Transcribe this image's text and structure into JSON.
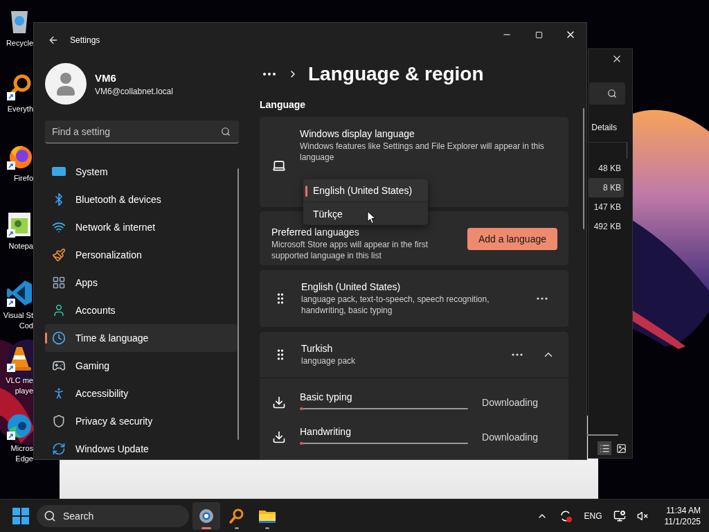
{
  "desktop": {
    "icons": [
      {
        "label": "Recycle",
        "kind": "recycle"
      },
      {
        "label": "Everyth",
        "kind": "everything"
      },
      {
        "label": "Firefo",
        "kind": "firefox"
      },
      {
        "label": "Notepa",
        "kind": "notepad"
      },
      {
        "label": "Visual St\nCod",
        "kind": "vscode"
      },
      {
        "label": "VLC me\nplaye",
        "kind": "vlc"
      },
      {
        "label": "Micros\nEdge",
        "kind": "edge"
      }
    ]
  },
  "explorer": {
    "view_label": "Details",
    "sizes": [
      {
        "text": "48 KB",
        "selected": false
      },
      {
        "text": "8 KB",
        "selected": true
      },
      {
        "text": "147 KB",
        "selected": false
      },
      {
        "text": "492 KB",
        "selected": false
      }
    ]
  },
  "settings": {
    "title": "Settings",
    "user": {
      "name": "VM6",
      "email": "VM6@collabnet.local"
    },
    "search": {
      "placeholder": "Find a setting"
    },
    "nav": [
      {
        "label": "System",
        "kind": "system",
        "selected": false
      },
      {
        "label": "Bluetooth & devices",
        "kind": "bluetooth",
        "selected": false
      },
      {
        "label": "Network & internet",
        "kind": "network",
        "selected": false
      },
      {
        "label": "Personalization",
        "kind": "brush",
        "selected": false
      },
      {
        "label": "Apps",
        "kind": "apps",
        "selected": false
      },
      {
        "label": "Accounts",
        "kind": "accounts",
        "selected": false
      },
      {
        "label": "Time & language",
        "kind": "time",
        "selected": true
      },
      {
        "label": "Gaming",
        "kind": "gaming",
        "selected": false
      },
      {
        "label": "Accessibility",
        "kind": "accessibility",
        "selected": false
      },
      {
        "label": "Privacy & security",
        "kind": "privacy",
        "selected": false
      },
      {
        "label": "Windows Update",
        "kind": "update",
        "selected": false
      }
    ],
    "page_title": "Language & region",
    "section": "Language",
    "display_language": {
      "title": "Windows display language",
      "description": "Windows features like Settings and File Explorer will appear in this language",
      "options": [
        {
          "label": "English (United States)",
          "selected": true
        },
        {
          "label": "Türkçe",
          "selected": false
        }
      ]
    },
    "preferred": {
      "title": "Preferred languages",
      "description": "Microsoft Store apps will appear in the first supported language in this list",
      "button": "Add a language"
    },
    "languages": [
      {
        "name": "English (United States)",
        "features": "language pack, text-to-speech, speech recognition, handwriting, basic typing",
        "expanded": false
      },
      {
        "name": "Turkish",
        "features": "language pack",
        "expanded": true,
        "downloads": [
          {
            "name": "Basic typing",
            "status": "Downloading",
            "level": 0.02
          },
          {
            "name": "Handwriting",
            "status": "Downloading",
            "level": 0.02
          }
        ]
      }
    ]
  },
  "taskbar": {
    "search": "Search",
    "apps": [
      {
        "kind": "settings",
        "active": true
      },
      {
        "kind": "everything",
        "active": false
      },
      {
        "kind": "explorer",
        "active": false
      }
    ],
    "language": "ENG",
    "time": "11:34 AM",
    "date": "11/1/2025"
  }
}
